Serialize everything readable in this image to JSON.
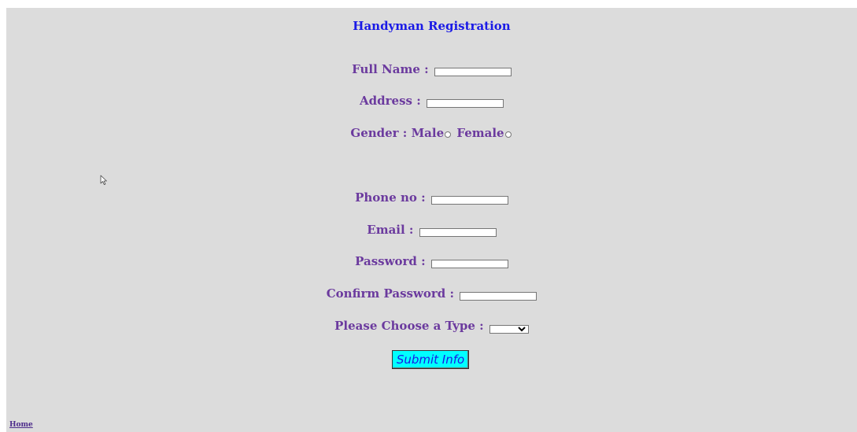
{
  "title": "Handyman Registration",
  "fields": {
    "full_name": {
      "label": "Full Name :",
      "value": ""
    },
    "address": {
      "label": "Address :",
      "value": ""
    },
    "gender": {
      "label": "Gender :",
      "male": "Male",
      "female": "Female"
    },
    "phone": {
      "label": "Phone no :",
      "value": ""
    },
    "email": {
      "label": "Email :",
      "value": ""
    },
    "password": {
      "label": "Password :",
      "value": ""
    },
    "confirm_password": {
      "label": "Confirm Password :",
      "value": ""
    },
    "type": {
      "label": "Please Choose a Type :",
      "selected": ""
    }
  },
  "submit_label": "Submit Info",
  "home_link": "Home",
  "icons": {
    "cursor": "mouse-pointer-icon"
  },
  "colors": {
    "background": "#dcdcdc",
    "title": "#1a1ae6",
    "label": "#6b3a9e",
    "submit_bg": "#00ffff"
  }
}
